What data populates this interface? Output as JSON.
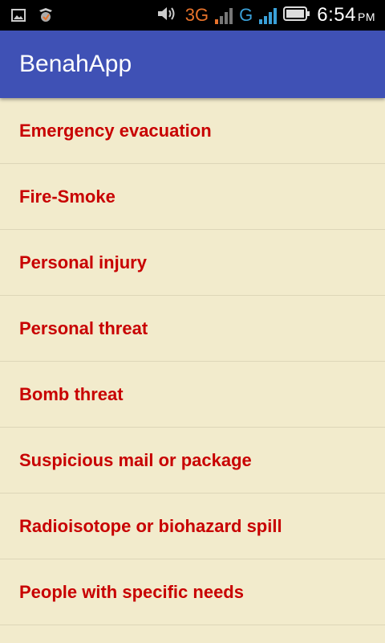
{
  "status_bar": {
    "network_3g": "3G",
    "network_g": "G",
    "time": "6:54",
    "ampm": "PM",
    "colors": {
      "net_3g": "#e8732b",
      "net_g": "#3aa0d8"
    },
    "icons": [
      "image-icon",
      "notification-app-icon",
      "volume-icon",
      "signal-icon",
      "battery-icon"
    ]
  },
  "app_bar": {
    "title": "BenahApp",
    "color": "#3f51b5"
  },
  "menu": {
    "item_color": "#c80000",
    "background": "#f2ebcc",
    "items": [
      {
        "label": "Emergency evacuation"
      },
      {
        "label": "Fire-Smoke"
      },
      {
        "label": "Personal injury"
      },
      {
        "label": "Personal threat"
      },
      {
        "label": "Bomb threat"
      },
      {
        "label": "Suspicious mail or package"
      },
      {
        "label": "Radioisotope or biohazard spill"
      },
      {
        "label": "People with specific needs"
      }
    ]
  }
}
